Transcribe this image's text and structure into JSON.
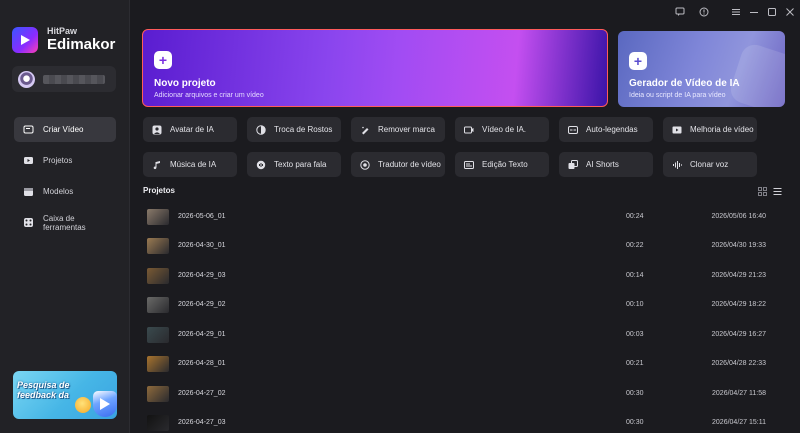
{
  "app": {
    "brand_line1": "HitPaw",
    "brand_line2": "Edimakor"
  },
  "account": {
    "name": "██████████"
  },
  "sidebar": {
    "items": [
      {
        "label": "Criar Vídeo",
        "icon": "create-video-icon",
        "active": true
      },
      {
        "label": "Projetos",
        "icon": "folder-icon",
        "active": false
      },
      {
        "label": "Modelos",
        "icon": "template-icon",
        "active": false
      },
      {
        "label": "Caixa de ferramentas",
        "icon": "toolbox-icon",
        "active": false
      }
    ],
    "promo": {
      "text": "Pesquisa de feedback da"
    }
  },
  "titlebar": {
    "buttons": [
      "feedback-icon",
      "info-icon",
      "menu-icon",
      "minimize-icon",
      "maximize-icon",
      "close-icon"
    ]
  },
  "cards": {
    "new_project": {
      "title": "Novo projeto",
      "subtitle": "Adicionar arquivos e criar um vídeo"
    },
    "ai_generator": {
      "title": "Gerador de Vídeo de IA",
      "subtitle": "Ideia ou script de IA para vídeo"
    }
  },
  "tools": [
    {
      "label": "Avatar de IA",
      "icon": "avatar-icon"
    },
    {
      "label": "Troca de Rostos",
      "icon": "face-swap-icon"
    },
    {
      "label": "Remover marca",
      "icon": "remove-watermark-icon"
    },
    {
      "label": "Vídeo de IA.",
      "icon": "ai-video-icon"
    },
    {
      "label": "Auto-legendas",
      "icon": "subtitles-icon"
    },
    {
      "label": "Melhoria de vídeo",
      "icon": "enhance-icon"
    },
    {
      "label": "Música de IA",
      "icon": "music-icon"
    },
    {
      "label": "Texto para fala",
      "icon": "text-to-speech-icon"
    },
    {
      "label": "Tradutor de vídeo",
      "icon": "translate-icon"
    },
    {
      "label": "Edição Texto",
      "icon": "text-edit-icon"
    },
    {
      "label": "AI Shorts",
      "icon": "shorts-icon"
    },
    {
      "label": "Clonar voz",
      "icon": "voice-clone-icon"
    }
  ],
  "projects": {
    "header": "Projetos",
    "view_icons": [
      "grid-view-icon",
      "list-view-icon"
    ],
    "rows": [
      {
        "name": "2026-05-06_01",
        "duration": "00:24",
        "date": "2026/05/06 16:40",
        "thumb_color": "#8a7a6a"
      },
      {
        "name": "2026-04-30_01",
        "duration": "00:22",
        "date": "2026/04/30 19:33",
        "thumb_color": "#9b7b52"
      },
      {
        "name": "2026-04-29_03",
        "duration": "00:14",
        "date": "2026/04/29 21:23",
        "thumb_color": "#7a5a34"
      },
      {
        "name": "2026-04-29_02",
        "duration": "00:10",
        "date": "2026/04/29 18:22",
        "thumb_color": "#6a6a68"
      },
      {
        "name": "2026-04-29_01",
        "duration": "00:03",
        "date": "2026/04/29 16:27",
        "thumb_color": "#3a4a4e"
      },
      {
        "name": "2026-04-28_01",
        "duration": "00:21",
        "date": "2026/04/28 22:33",
        "thumb_color": "#a8742e"
      },
      {
        "name": "2026-04-27_02",
        "duration": "00:30",
        "date": "2026/04/27 11:58",
        "thumb_color": "#8e6a3c"
      },
      {
        "name": "2026-04-27_03",
        "duration": "00:30",
        "date": "2026/04/27 15:11",
        "thumb_color": "#121212"
      }
    ]
  }
}
